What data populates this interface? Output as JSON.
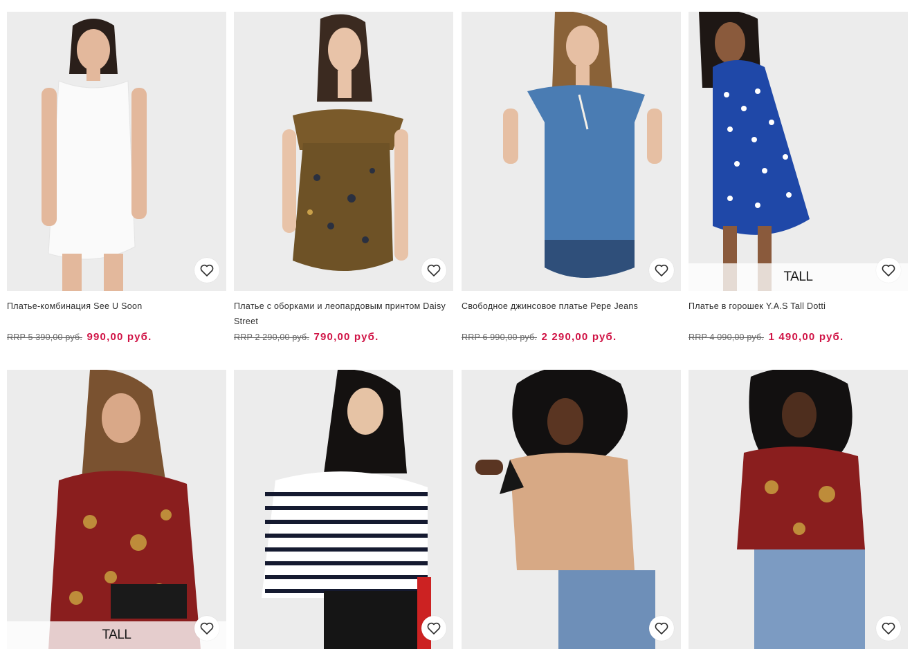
{
  "products": [
    {
      "title": "Платье-комбинация See U Soon",
      "old_price": "RRP 5 390,00 руб.",
      "price": "990,00 руб.",
      "badge": ""
    },
    {
      "title": "Платье с оборками и леопардовым принтом Daisy Street",
      "old_price": "RRP 2 290,00 руб.",
      "price": "790,00 руб.",
      "badge": ""
    },
    {
      "title": "Свободное джинсовое платье Pepe Jeans",
      "old_price": "RRP 6 990,00 руб.",
      "price": "2 290,00 руб.",
      "badge": ""
    },
    {
      "title": "Платье в горошек Y.A.S Tall Dotti",
      "old_price": "RRP 4 090,00 руб.",
      "price": "1 490,00 руб.",
      "badge": "TALL"
    },
    {
      "title": "",
      "old_price": "",
      "price": "",
      "badge": "TALL"
    },
    {
      "title": "",
      "old_price": "",
      "price": "",
      "badge": ""
    },
    {
      "title": "",
      "old_price": "",
      "price": "",
      "badge": ""
    },
    {
      "title": "",
      "old_price": "",
      "price": "",
      "badge": ""
    }
  ],
  "icons": {
    "favorite": "heart-outline-icon"
  },
  "colors": {
    "sale_price": "#d01345",
    "text": "#2d2d2d",
    "old_price": "#666666"
  }
}
